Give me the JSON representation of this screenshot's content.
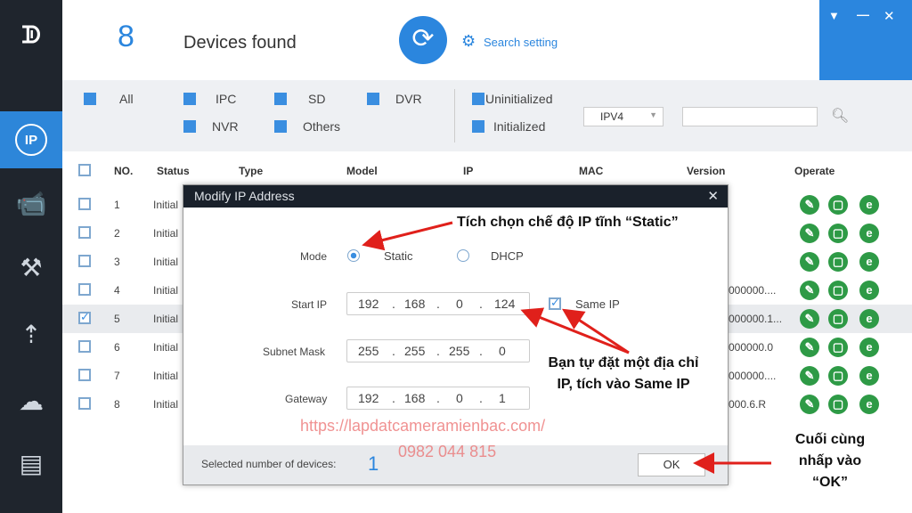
{
  "header": {
    "count": "8",
    "title": "Devices found",
    "search_setting": "Search setting"
  },
  "window_controls": [
    "▼",
    "—",
    "✕"
  ],
  "filters": {
    "all": "All",
    "ipc": "IPC",
    "sd": "SD",
    "dvr": "DVR",
    "nvr": "NVR",
    "others": "Others",
    "uninitialized": "Uninitialized",
    "initialized": "Initialized",
    "ip_version": "IPV4",
    "search_value": ""
  },
  "table": {
    "headers": [
      "NO.",
      "Status",
      "Type",
      "Model",
      "IP",
      "MAC",
      "Version",
      "Operate"
    ],
    "rows": [
      {
        "no": "1",
        "status": "Initial",
        "version": "",
        "checked": false
      },
      {
        "no": "2",
        "status": "Initial",
        "version": "",
        "checked": false
      },
      {
        "no": "3",
        "status": "Initial",
        "version": "",
        "checked": false
      },
      {
        "no": "4",
        "status": "Initial",
        "version": "000000....",
        "checked": false
      },
      {
        "no": "5",
        "status": "Initial",
        "version": "000000.1...",
        "checked": true
      },
      {
        "no": "6",
        "status": "Initial",
        "version": "000000.0",
        "checked": false
      },
      {
        "no": "7",
        "status": "Initial",
        "version": "000000....",
        "checked": false
      },
      {
        "no": "8",
        "status": "Initial",
        "version": "000.6.R",
        "checked": false
      }
    ]
  },
  "dialog": {
    "title": "Modify IP Address",
    "mode_label": "Mode",
    "static": "Static",
    "dhcp": "DHCP",
    "mode_selected": "Static",
    "start_ip_label": "Start IP",
    "start_ip": [
      "192",
      "168",
      "0",
      "124"
    ],
    "same_ip": "Same IP",
    "same_ip_checked": true,
    "subnet_label": "Subnet Mask",
    "subnet": [
      "255",
      "255",
      "255",
      "0"
    ],
    "gateway_label": "Gateway",
    "gateway": [
      "192",
      "168",
      "0",
      "1"
    ],
    "selected_label": "Selected number of devices:",
    "selected_count": "1",
    "ok": "OK"
  },
  "annotations": {
    "static_note": "Tích chọn chế độ IP tĩnh “Static”",
    "ip_note_1": "Bạn tự đặt một địa chỉ",
    "ip_note_2": "IP, tích vào Same IP",
    "ok_note_1": "Cuối cùng",
    "ok_note_2": "nhấp vào",
    "ok_note_3": "“OK”"
  },
  "watermark": {
    "url": "https://lapdatcameramienbac.com/",
    "phone": "0982 044 815"
  },
  "colors": {
    "sidebar": "#1f252d",
    "accent": "#2b86de",
    "operate": "#2e9a46",
    "annotation_arrow": "#e0201b"
  }
}
